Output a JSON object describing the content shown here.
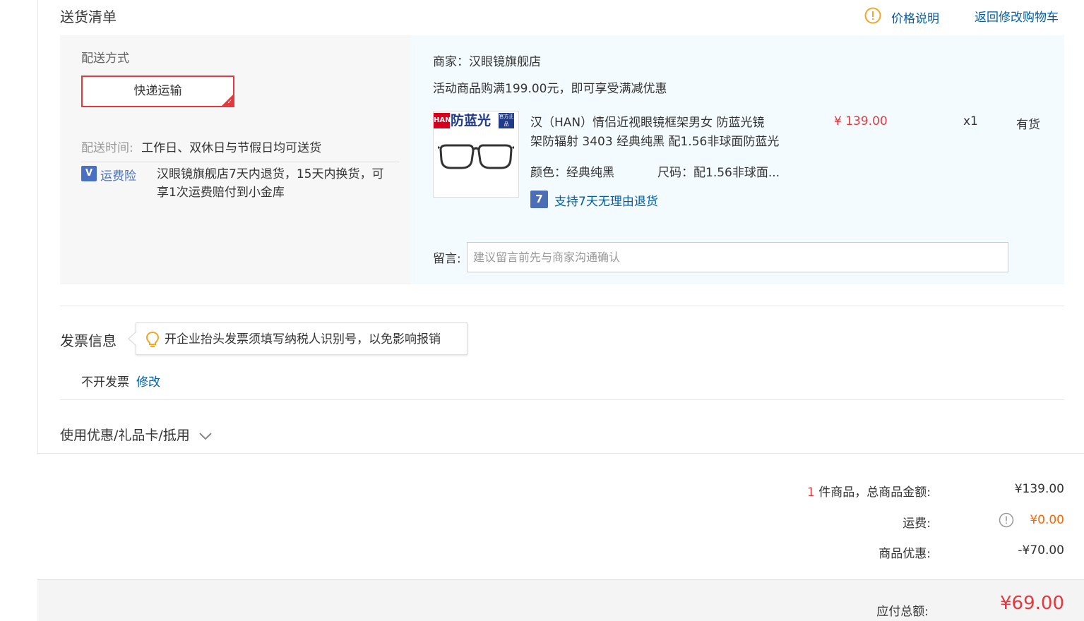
{
  "section_title": "送货清单",
  "header_links": {
    "price_note": "价格说明",
    "back_to_cart": "返回修改购物车"
  },
  "delivery": {
    "method_label": "配送方式",
    "method_button": "快递运输",
    "time_label": "配送时间:",
    "time_value": "工作日、双休日与节假日均可送货",
    "insurance_label": "运费险",
    "insurance_desc_line1": "汉眼镜旗舰店7天内退货，15天内换货，可",
    "insurance_desc_line2": "享1次运费赔付到小金库"
  },
  "shop": {
    "merchant": "商家：汉眼镜旗舰店",
    "promo": "活动商品购满199.00元，即可享受满减优惠"
  },
  "product": {
    "thumb_brand": "HAN",
    "thumb_tag": "防蓝光",
    "thumb_flag": "官方正品",
    "name_line1": "汉（HAN）情侣近视眼镜框架男女 防蓝光镜",
    "name_line2": "架防辐射 3403 经典纯黑 配1.56非球面防蓝光",
    "price": "¥ 139.00",
    "quantity": "x1",
    "stock": "有货",
    "color": "颜色：经典纯黑",
    "size": "尺码：配1.56非球面...",
    "return_policy": "支持7天无理由退货"
  },
  "message": {
    "label": "留言:",
    "placeholder": "建议留言前先与商家沟通确认"
  },
  "invoice": {
    "title": "发票信息",
    "tip": "开企业抬头发票须填写纳税人识别号，以免影响报销",
    "status": "不开发票",
    "edit": "修改"
  },
  "coupon": {
    "label": "使用优惠/礼品卡/抵用"
  },
  "summary": {
    "count": "1",
    "count_suffix": "件商品，总商品金额:",
    "total": "¥139.00",
    "shipping_label": "运费:",
    "shipping_value": "¥0.00",
    "discount_label": "商品优惠:",
    "discount_value": "-¥70.00",
    "payable_label": "应付总额:",
    "payable_value": "¥69.00"
  },
  "colors": {
    "accent_red": "#e4393c",
    "link_blue": "#005ea7",
    "orange": "#f5a623"
  }
}
